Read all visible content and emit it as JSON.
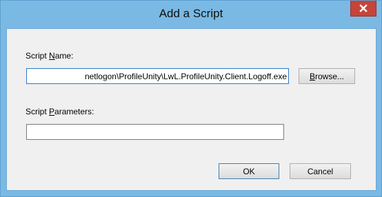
{
  "window": {
    "title": "Add a Script",
    "close_glyph": "close-icon"
  },
  "form": {
    "script_name_label_prefix": "Script ",
    "script_name_label_accel": "N",
    "script_name_label_suffix": "ame:",
    "script_name_value": "netlogon\\ProfileUnity\\LwL.ProfileUnity.Client.Logoff.exe",
    "script_params_label_prefix": "Script ",
    "script_params_label_accel": "P",
    "script_params_label_suffix": "arameters:",
    "script_params_value": ""
  },
  "buttons": {
    "browse_accel": "B",
    "browse_rest": "rowse...",
    "ok": "OK",
    "cancel": "Cancel"
  },
  "colors": {
    "frame": "#79b9e4",
    "close": "#c6443a",
    "client": "#f0f0f0"
  }
}
